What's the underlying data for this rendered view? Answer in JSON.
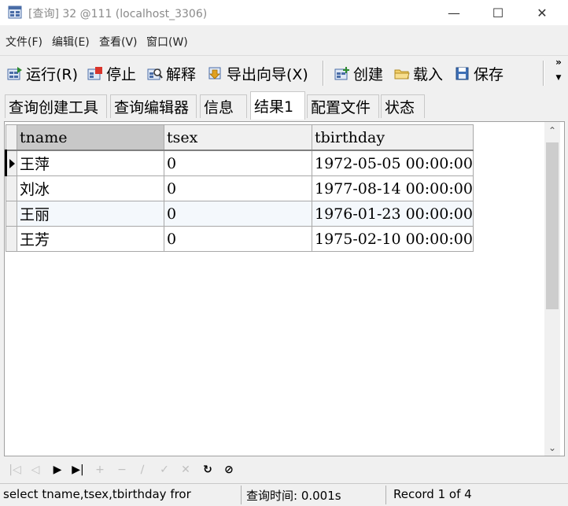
{
  "window": {
    "title": "[查询] 32 @111 (localhost_3306)",
    "minimize": "—",
    "maximize": "☐",
    "close": "✕"
  },
  "menu": [
    "文件(F)",
    "编辑(E)",
    "查看(V)",
    "窗口(W)"
  ],
  "toolbar": {
    "run": "运行(R)",
    "stop": "停止",
    "explain": "解释",
    "export": "导出向导(X)",
    "create": "创建",
    "load": "载入",
    "save": "保存"
  },
  "tabs": [
    "查询创建工具",
    "查询编辑器",
    "信息",
    "结果1",
    "配置文件",
    "状态"
  ],
  "active_tab": "结果1",
  "grid": {
    "columns": [
      "tname",
      "tsex",
      "tbirthday"
    ],
    "rows": [
      [
        "王萍",
        "0",
        "1972-05-05 00:00:00"
      ],
      [
        "刘冰",
        "0",
        "1977-08-14 00:00:00"
      ],
      [
        "王丽",
        "0",
        "1976-01-23 00:00:00"
      ],
      [
        "王芳",
        "0",
        "1975-02-10 00:00:00"
      ]
    ]
  },
  "status": {
    "sql": "select tname,tsex,tbirthday fror",
    "query_time": "查询时间: 0.001s",
    "record": "Record 1 of 4"
  },
  "icons": {
    "app": "database-window-icon",
    "run": "run-icon",
    "stop": "stop-icon",
    "explain": "explain-icon",
    "export": "export-icon",
    "create": "create-icon",
    "load": "load-folder-icon",
    "save": "floppy-save-icon"
  }
}
